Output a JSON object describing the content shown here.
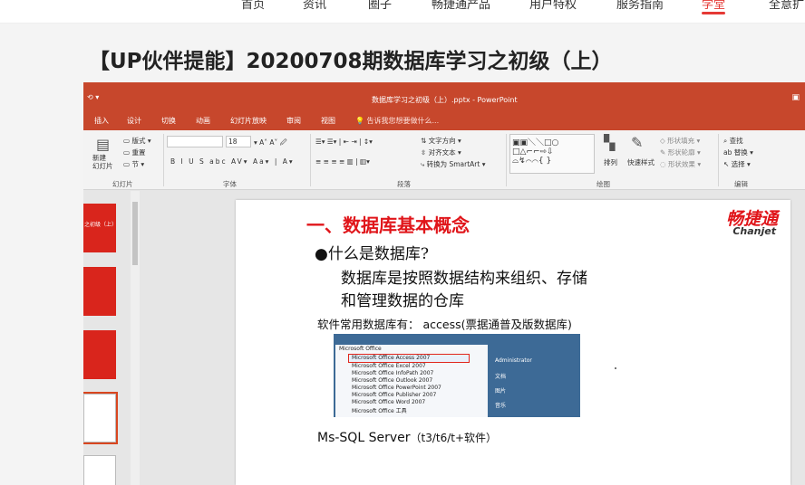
{
  "site_nav": {
    "items": [
      "首页",
      "资讯",
      "圈子",
      "畅捷通产品",
      "用户特权",
      "服务指南",
      "学堂",
      "全意扩"
    ],
    "active_index": 6
  },
  "page_title": "【UP伙伴提能】20200708期数据库学习之初级（上）",
  "ppt": {
    "window_title": "数据库学习之初级（上）.pptx - PowerPoint",
    "ribbon_tabs": [
      "插入",
      "设计",
      "切换",
      "动画",
      "幻灯片放映",
      "审阅",
      "视图"
    ],
    "tell_me": "告诉我您想要做什么...",
    "groups": {
      "slides": {
        "label": "幻灯片",
        "new_slide": "新建\n幻灯片",
        "layout": "版式",
        "reset": "重置",
        "section": "节"
      },
      "font": {
        "label": "字体",
        "size": "18"
      },
      "paragraph": {
        "label": "段落",
        "text_direction": "文字方向",
        "align_text": "对齐文本",
        "smartart": "转换为 SmartArt"
      },
      "drawing": {
        "label": "绘图",
        "arrange": "排列",
        "quick_styles": "快速样式",
        "fill": "形状填充",
        "outline": "形状轮廓",
        "effects": "形状效果"
      },
      "editing": {
        "label": "编辑",
        "find": "查找",
        "replace": "替换",
        "select": "选择"
      }
    },
    "thumbnails": [
      {
        "text": "之初级（上）"
      },
      {
        "text": ""
      },
      {
        "text": ""
      },
      {
        "text": ""
      },
      {
        "text": ""
      }
    ],
    "slide": {
      "heading": "一、数据库基本概念",
      "logo_cn": "畅捷通",
      "logo_en": "Chanjet",
      "question": "●什么是数据库?",
      "definition_1": "数据库是按照数据结构来组织、存储",
      "definition_2": "和管理数据的仓库",
      "common": "软件常用数据库有：  access(票据通普及版数据库)",
      "sql_main": "Ms-SQL Server",
      "sql_note": "（t3/t6/t+软件）",
      "embedded_menu": {
        "items": [
          "Microsoft Office",
          "Microsoft Office Access 2007",
          "Microsoft Office Excel 2007",
          "Microsoft Office InfoPath 2007",
          "Microsoft Office Outlook 2007",
          "Microsoft Office PowerPoint 2007",
          "Microsoft Office Publisher 2007",
          "Microsoft Office Word 2007",
          "Microsoft Office 工具"
        ],
        "right_items": [
          "Administrator",
          "文档",
          "图片",
          "音乐"
        ]
      }
    }
  },
  "colors": {
    "accent": "#e53935",
    "ppt_red": "#c7472c",
    "slide_red": "#e0151a"
  }
}
